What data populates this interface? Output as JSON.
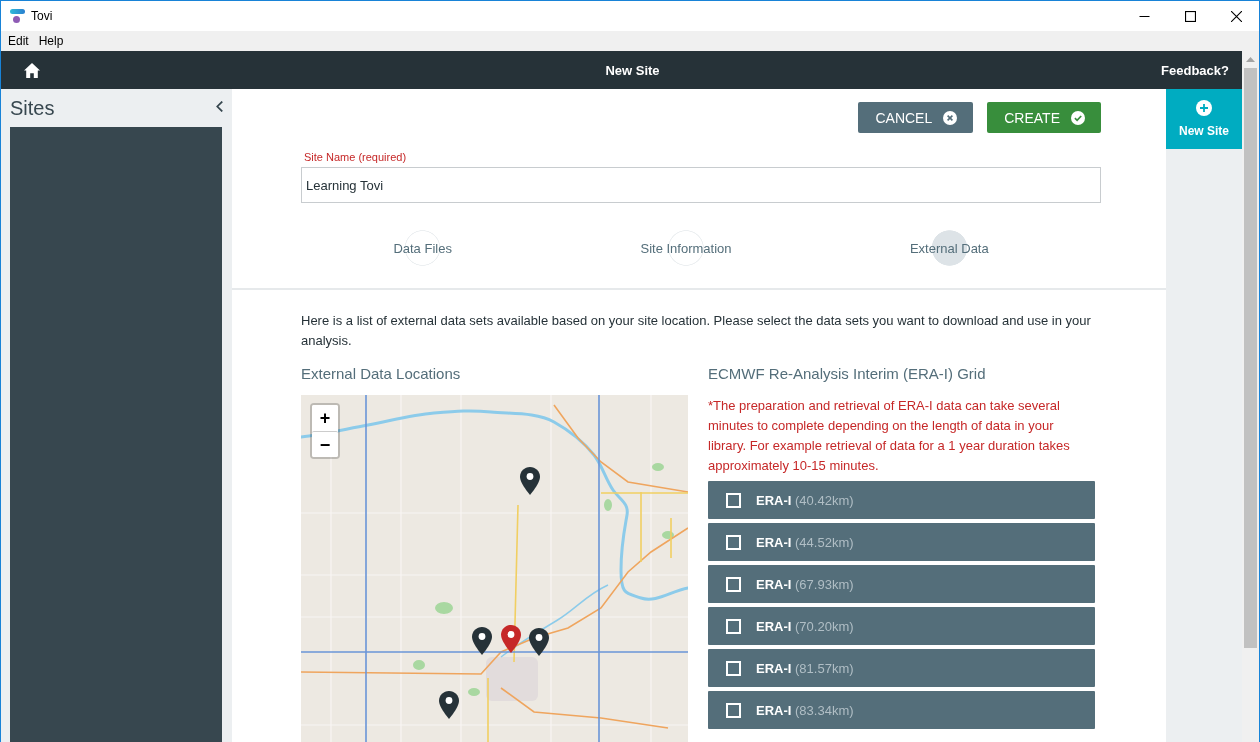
{
  "window": {
    "title": "Tovi"
  },
  "menu": [
    "Edit",
    "Help"
  ],
  "header": {
    "title": "New Site",
    "feedback": "Feedback?"
  },
  "sidebar": {
    "title": "Sites"
  },
  "actions": [
    {
      "label": "CANCEL",
      "kind": "cancel"
    },
    {
      "label": "CREATE",
      "kind": "create"
    }
  ],
  "site_name": {
    "label": "Site Name (required)",
    "value": "Learning Tovi"
  },
  "steps": [
    {
      "label": "Data Files",
      "selected": false
    },
    {
      "label": "Site Information",
      "selected": false
    },
    {
      "label": "External Data",
      "selected": true
    }
  ],
  "intro": "Here is a list of external data sets available based on your site location. Please select the data sets you want to download and use in your analysis.",
  "locations": {
    "title": "External Data Locations",
    "zoom": [
      "+",
      "−"
    ],
    "markers": [
      {
        "kind": "grid"
      },
      {
        "kind": "grid"
      },
      {
        "kind": "site"
      },
      {
        "kind": "grid"
      },
      {
        "kind": "grid"
      }
    ]
  },
  "grid": {
    "title": "ECMWF Re-Analysis Interim (ERA-I) Grid",
    "note": "*The preparation and retrieval of ERA-I data can take several minutes to complete depending on the length of data in your library. For example retrieval of data for a 1 year duration takes approximately 10-15 minutes.",
    "options": [
      {
        "name": "ERA-I",
        "distance": "(40.42km)",
        "checked": false
      },
      {
        "name": "ERA-I",
        "distance": "(44.52km)",
        "checked": false
      },
      {
        "name": "ERA-I",
        "distance": "(67.93km)",
        "checked": false
      },
      {
        "name": "ERA-I",
        "distance": "(70.20km)",
        "checked": false
      },
      {
        "name": "ERA-I",
        "distance": "(81.57km)",
        "checked": false
      },
      {
        "name": "ERA-I",
        "distance": "(83.34km)",
        "checked": false
      }
    ]
  },
  "right_panel": {
    "new_site": "New Site"
  }
}
